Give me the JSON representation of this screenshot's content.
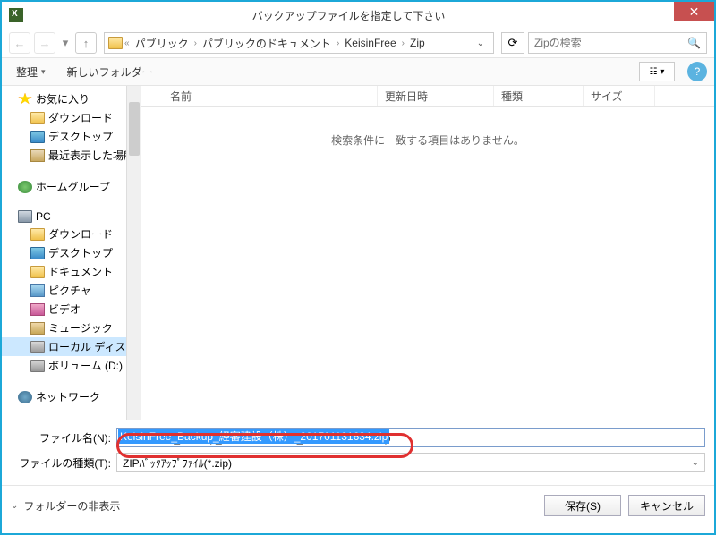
{
  "title": "バックアップファイルを指定して下さい",
  "nav": {
    "breadcrumb": [
      "パブリック",
      "パブリックのドキュメント",
      "KeisinFree",
      "Zip"
    ],
    "search_placeholder": "Zipの検索"
  },
  "toolbar": {
    "organize": "整理",
    "newfolder": "新しいフォルダー"
  },
  "sidebar": {
    "favorites": "お気に入り",
    "downloads": "ダウンロード",
    "desktop": "デスクトップ",
    "recent": "最近表示した場所",
    "homegroup": "ホームグループ",
    "pc": "PC",
    "pc_downloads": "ダウンロード",
    "pc_desktop": "デスクトップ",
    "pc_documents": "ドキュメント",
    "pc_pictures": "ピクチャ",
    "pc_videos": "ビデオ",
    "pc_music": "ミュージック",
    "pc_localdisk": "ローカル ディスク (C",
    "pc_volume": "ボリューム (D:)",
    "network": "ネットワーク"
  },
  "columns": {
    "name": "名前",
    "date": "更新日時",
    "type": "種類",
    "size": "サイズ"
  },
  "empty_msg": "検索条件に一致する項目はありません。",
  "form": {
    "filename_label": "ファイル名(N):",
    "filename_value": "KeisinFree_Backup_経審建設（株）_201701131634.zip",
    "filetype_label": "ファイルの種類(T):",
    "filetype_value": "ZIPﾊﾞｯｸｱｯﾌﾟﾌｧｲﾙ(*.zip)"
  },
  "footer": {
    "hide_folders": "フォルダーの非表示",
    "save": "保存(S)",
    "cancel": "キャンセル"
  }
}
